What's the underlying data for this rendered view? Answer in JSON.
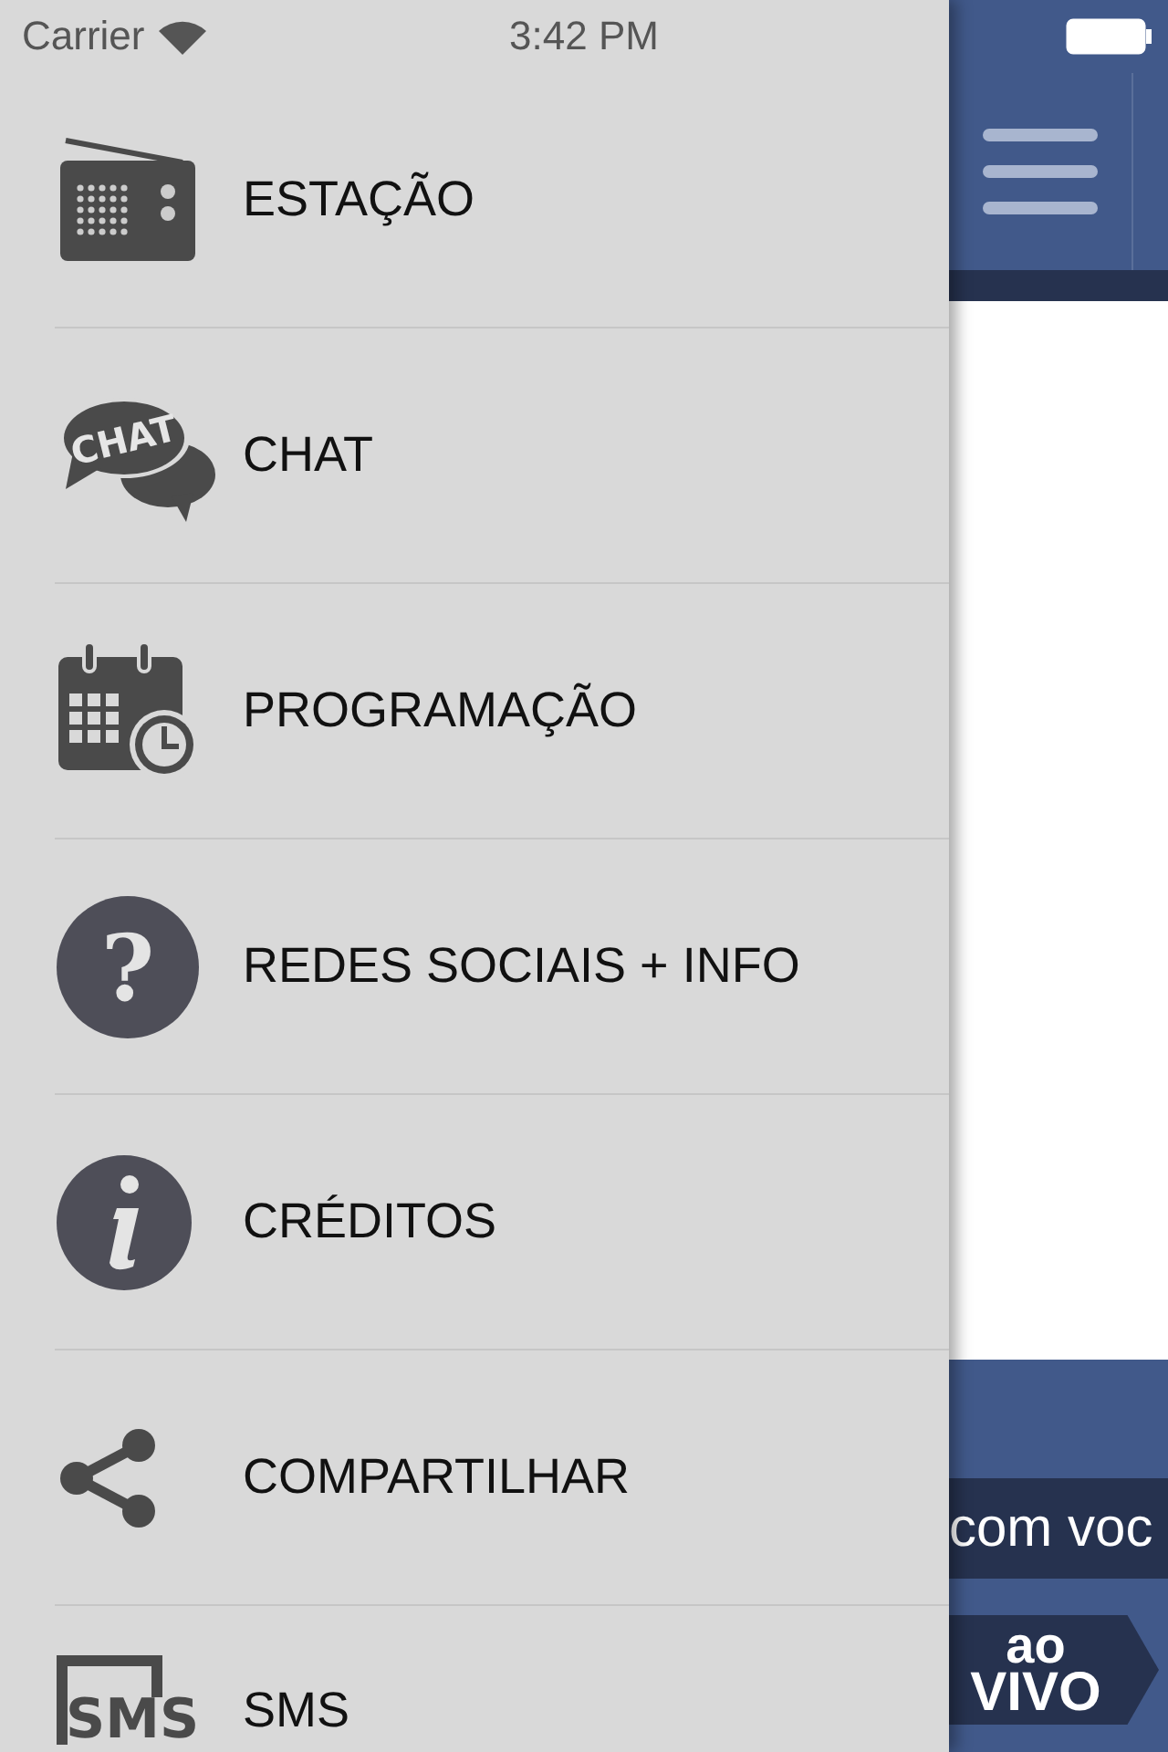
{
  "status_bar": {
    "carrier": "Carrier",
    "time": "3:42 PM"
  },
  "menu": {
    "items": [
      {
        "label": "ESTAÇÃO",
        "kind": "radio"
      },
      {
        "label": "CHAT",
        "kind": "chat",
        "icon_text": "CHAT"
      },
      {
        "label": "PROGRAMAÇÃO",
        "kind": "calendar"
      },
      {
        "label": "REDES SOCIAIS + INFO",
        "kind": "question",
        "icon_text": "?"
      },
      {
        "label": "CRÉDITOS",
        "kind": "info"
      },
      {
        "label": "COMPARTILHAR",
        "kind": "share"
      },
      {
        "label": "SMS",
        "kind": "sms",
        "icon_text": "SMS"
      }
    ]
  },
  "main": {
    "ticker_text": "com voc",
    "live_badge": {
      "line_1": "ao",
      "line_2": "VIVO"
    }
  }
}
